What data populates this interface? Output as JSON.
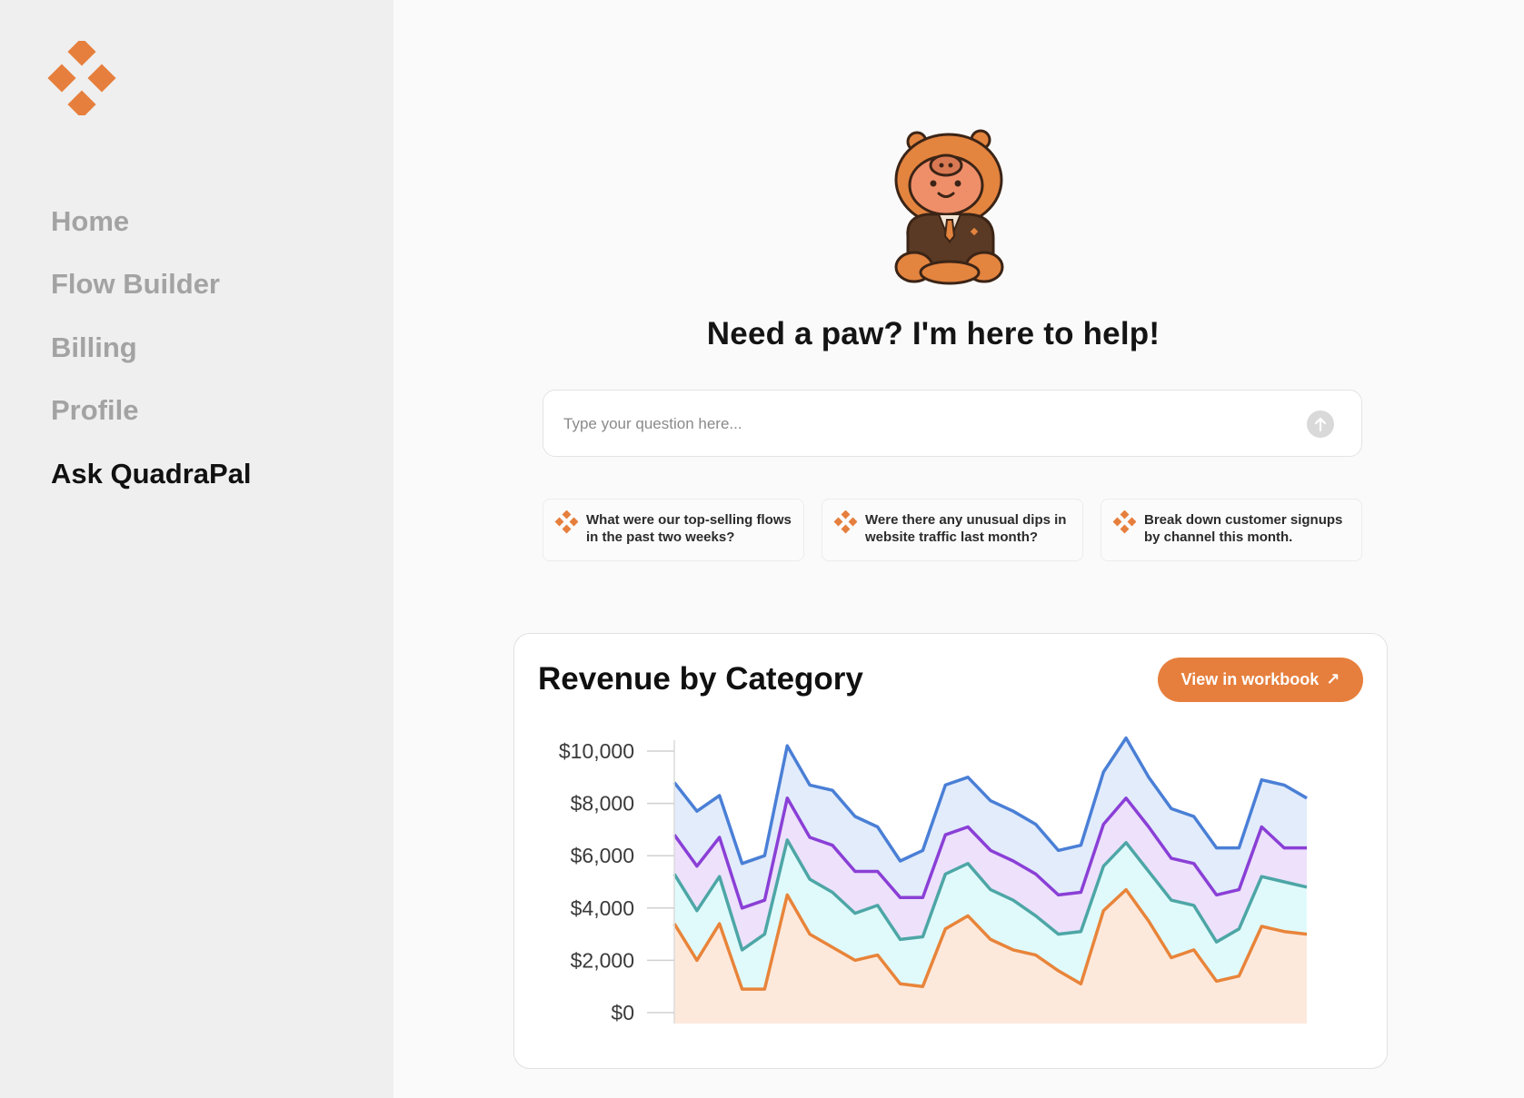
{
  "sidebar": {
    "items": [
      {
        "label": "Home",
        "active": false
      },
      {
        "label": "Flow Builder",
        "active": false
      },
      {
        "label": "Billing",
        "active": false
      },
      {
        "label": "Profile",
        "active": false
      },
      {
        "label": "Ask QuadraPal",
        "active": true
      }
    ]
  },
  "assistant": {
    "headline": "Need a paw? I'm here to help!",
    "input_placeholder": "Type your question here...",
    "input_value": "",
    "suggestions": [
      {
        "text": "What were our top-selling flows in the past two weeks?"
      },
      {
        "text": "Were there any unusual dips in website traffic last month?"
      },
      {
        "text": "Break down customer signups by channel this month."
      }
    ]
  },
  "chart_card": {
    "title": "Revenue by Category",
    "button_label": "View in workbook",
    "button_icon": "arrow-up-right-icon"
  },
  "colors": {
    "accent": "#e67f3d",
    "series": [
      "#e8843a",
      "#4da6a6",
      "#8a3fd6",
      "#4a7fd6"
    ],
    "fills": [
      "#fde9dc",
      "#e0fafb",
      "#ede1fb",
      "#e2ecfb"
    ]
  },
  "chart_data": {
    "type": "area",
    "stacked": true,
    "title": "Revenue by Category",
    "xlabel": "",
    "ylabel": "",
    "ylim": [
      0,
      10000
    ],
    "yticks": [
      "$0",
      "$2,000",
      "$4,000",
      "$6,000",
      "$8,000",
      "$10,000"
    ],
    "grid": false,
    "legend": "none",
    "cumulative_series": [
      {
        "values": [
          3400,
          2000,
          3400,
          900,
          900,
          4500,
          3000,
          2500,
          2000,
          2200,
          1100,
          1000,
          3200,
          3700,
          2800,
          2400,
          2200,
          1600,
          1100,
          3900,
          4700,
          3500,
          2100,
          2400,
          1200,
          1400,
          3300,
          3100,
          3000
        ]
      },
      {
        "values": [
          5300,
          3900,
          5200,
          2400,
          3000,
          6600,
          5100,
          4600,
          3800,
          4100,
          2800,
          2900,
          5300,
          5700,
          4700,
          4300,
          3700,
          3000,
          3100,
          5600,
          6500,
          5400,
          4300,
          4100,
          2700,
          3200,
          5200,
          5000,
          4800
        ]
      },
      {
        "values": [
          6800,
          5600,
          6700,
          4000,
          4300,
          8200,
          6700,
          6400,
          5400,
          5400,
          4400,
          4400,
          6800,
          7100,
          6200,
          5800,
          5300,
          4500,
          4600,
          7200,
          8200,
          7100,
          5900,
          5700,
          4500,
          4700,
          7100,
          6300,
          6300
        ]
      },
      {
        "values": [
          8800,
          7700,
          8300,
          5700,
          6000,
          10200,
          8700,
          8500,
          7500,
          7100,
          5800,
          6200,
          8700,
          9000,
          8100,
          7700,
          7200,
          6200,
          6400,
          9200,
          10500,
          9000,
          7800,
          7500,
          6300,
          6300,
          8900,
          8700,
          8200
        ]
      }
    ]
  }
}
